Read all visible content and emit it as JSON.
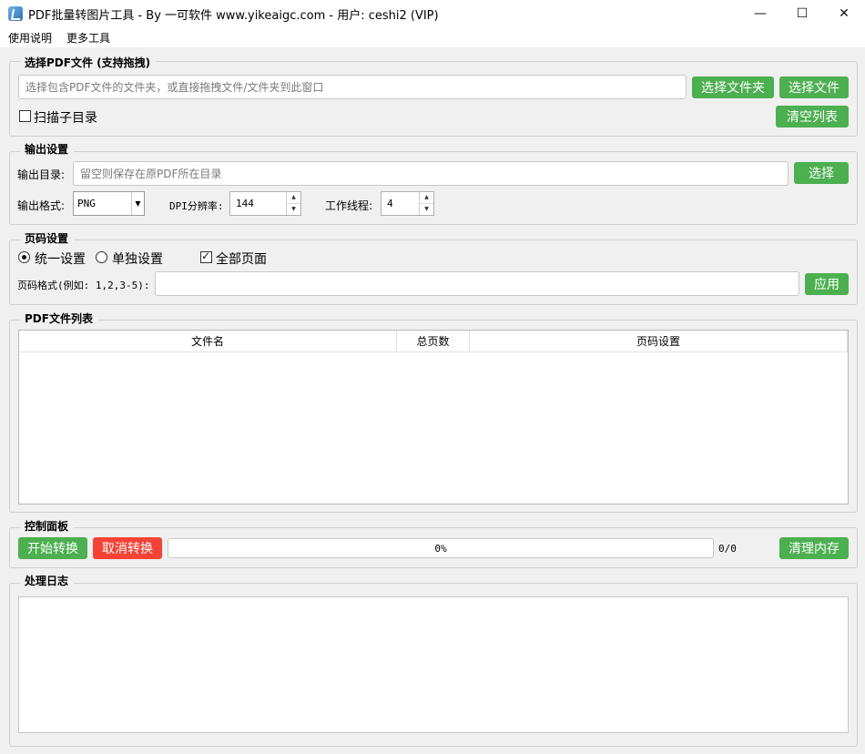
{
  "window": {
    "title": "PDF批量转图片工具 - By 一可软件 www.yikeaigc.com - 用户: ceshi2 (VIP)",
    "minimize": "—",
    "maximize": "☐",
    "close": "✕"
  },
  "menu": {
    "items": [
      "使用说明",
      "更多工具"
    ]
  },
  "select_group": {
    "title": "选择PDF文件 (支持拖拽)",
    "path_placeholder": "选择包含PDF文件的文件夹，或直接拖拽文件/文件夹到此窗口",
    "choose_folder": "选择文件夹",
    "choose_file": "选择文件",
    "scan_subdirs": "扫描子目录",
    "scan_subdirs_checked": false,
    "clear_list": "清空列表"
  },
  "output_group": {
    "title": "输出设置",
    "dir_label": "输出目录:",
    "dir_placeholder": "留空则保存在原PDF所在目录",
    "choose": "选择",
    "format_label": "输出格式:",
    "format_value": "PNG",
    "dpi_label": "DPI分辨率:",
    "dpi_value": "144",
    "threads_label": "工作线程:",
    "threads_value": "4"
  },
  "page_group": {
    "title": "页码设置",
    "unified": "统一设置",
    "unified_checked": true,
    "individual": "单独设置",
    "individual_checked": false,
    "all_pages": "全部页面",
    "all_pages_checked": true,
    "format_label": "页码格式(例如: 1,2,3-5):",
    "format_value": "",
    "apply": "应用"
  },
  "list_group": {
    "title": "PDF文件列表",
    "columns": [
      "文件名",
      "总页数",
      "页码设置"
    ],
    "rows": []
  },
  "control_group": {
    "title": "控制面板",
    "start": "开始转换",
    "cancel": "取消转换",
    "progress_text": "0%",
    "progress_value": 0,
    "count": "0/0",
    "clear_memory": "清理内存"
  },
  "log_group": {
    "title": "处理日志",
    "content": ""
  },
  "colors": {
    "green": "#4caf50",
    "red": "#f44336"
  }
}
